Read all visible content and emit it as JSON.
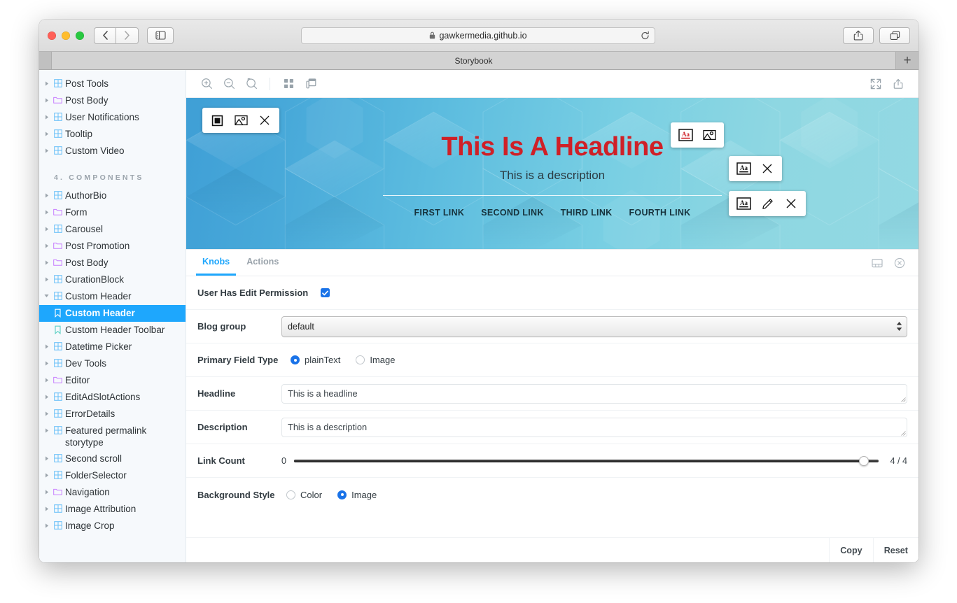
{
  "browser": {
    "url": "gawkermedia.github.io",
    "lock_icon": "lock-icon",
    "reload_icon": "reload-icon",
    "back_icon": "chevron-left-icon",
    "forward_icon": "chevron-right-icon",
    "sidebar_toggle_icon": "sidebar-toggle-icon",
    "share_icon": "share-icon",
    "tab_overview_icon": "tab-overview-icon",
    "tab_title": "Storybook",
    "new_tab_label": "+"
  },
  "sidebar": {
    "items": [
      {
        "label": "Post Tools",
        "type": "component",
        "caret": true,
        "selected": false
      },
      {
        "label": "Post Body",
        "type": "folder",
        "caret": true,
        "selected": false
      },
      {
        "label": "User Notifications",
        "type": "component",
        "caret": true,
        "selected": false
      },
      {
        "label": "Tooltip",
        "type": "component",
        "caret": true,
        "selected": false
      },
      {
        "label": "Custom Video",
        "type": "component",
        "caret": true,
        "selected": false
      }
    ],
    "group_title": "4. COMPONENTS",
    "components": [
      {
        "label": "AuthorBio",
        "type": "component",
        "caret": true,
        "selected": false
      },
      {
        "label": "Form",
        "type": "folder",
        "caret": true,
        "selected": false
      },
      {
        "label": "Carousel",
        "type": "component",
        "caret": true,
        "selected": false
      },
      {
        "label": "Post Promotion",
        "type": "folder",
        "caret": true,
        "selected": false
      },
      {
        "label": "Post Body",
        "type": "folder",
        "caret": true,
        "selected": false
      },
      {
        "label": "CurationBlock",
        "type": "component",
        "caret": true,
        "selected": false
      },
      {
        "label": "Custom Header",
        "type": "component",
        "caret": "open",
        "selected": false
      },
      {
        "label": "Custom Header",
        "type": "story",
        "caret": false,
        "selected": true
      },
      {
        "label": "Custom Header Toolbar",
        "type": "story",
        "caret": false,
        "selected": false
      },
      {
        "label": "Datetime Picker",
        "type": "component",
        "caret": true,
        "selected": false
      },
      {
        "label": "Dev Tools",
        "type": "component",
        "caret": true,
        "selected": false
      },
      {
        "label": "Editor",
        "type": "folder",
        "caret": true,
        "selected": false
      },
      {
        "label": "EditAdSlotActions",
        "type": "component",
        "caret": true,
        "selected": false
      },
      {
        "label": "ErrorDetails",
        "type": "component",
        "caret": true,
        "selected": false
      },
      {
        "label": "Featured permalink storytype",
        "type": "component",
        "caret": true,
        "selected": false
      },
      {
        "label": "Second scroll",
        "type": "component",
        "caret": true,
        "selected": false
      },
      {
        "label": "FolderSelector",
        "type": "component",
        "caret": true,
        "selected": false
      },
      {
        "label": "Navigation",
        "type": "folder",
        "caret": true,
        "selected": false
      },
      {
        "label": "Image Attribution",
        "type": "component",
        "caret": true,
        "selected": false
      },
      {
        "label": "Image Crop",
        "type": "component",
        "caret": true,
        "selected": false
      }
    ]
  },
  "preview_toolbar": {
    "zoom_in_icon": "zoom-in-icon",
    "zoom_out_icon": "zoom-out-icon",
    "zoom_reset_icon": "zoom-reset-icon",
    "grid_icon": "grid-icon",
    "background_icon": "layers-icon",
    "fullscreen_icon": "fullscreen-icon",
    "open_new_tab_icon": "share-icon"
  },
  "preview": {
    "headline": "This Is A Headline",
    "description": "This is a description",
    "links": [
      "FIRST LINK",
      "SECOND LINK",
      "THIRD LINK",
      "FOURTH LINK"
    ],
    "headline_color": "#cf2027",
    "description_color": "#2b3a41",
    "link_color": "#17333d",
    "bg_from": "#3f9fd6",
    "bg_to": "#93d9e3",
    "toolbars": {
      "background": {
        "icons": [
          "color-swatch-icon",
          "image-icon",
          "close-icon"
        ]
      },
      "headline": {
        "icons": [
          "text-format-red-icon",
          "image-icon"
        ]
      },
      "description": {
        "icons": [
          "text-format-icon",
          "close-icon"
        ]
      },
      "links": {
        "icons": [
          "text-format-icon",
          "pencil-icon",
          "close-icon"
        ]
      }
    }
  },
  "addon_panel": {
    "tabs": [
      {
        "label": "Knobs",
        "active": true
      },
      {
        "label": "Actions",
        "active": false
      }
    ],
    "position_icon": "panel-position-icon",
    "close_icon": "close-circle-icon",
    "knobs": {
      "user_has_edit_permission": {
        "label": "User Has Edit Permission",
        "checked": true
      },
      "blog_group": {
        "label": "Blog group",
        "value": "default",
        "options": [
          "default"
        ]
      },
      "primary_field_type": {
        "label": "Primary Field Type",
        "options": [
          {
            "label": "plainText",
            "selected": true
          },
          {
            "label": "Image",
            "selected": false
          }
        ]
      },
      "headline": {
        "label": "Headline",
        "value": "This is a headline"
      },
      "description": {
        "label": "Description",
        "value": "This is a description"
      },
      "link_count": {
        "label": "Link Count",
        "min": "0",
        "value": 4,
        "max": 4,
        "readout": "4 / 4"
      },
      "background_style": {
        "label": "Background Style",
        "options": [
          {
            "label": "Color",
            "selected": false
          },
          {
            "label": "Image",
            "selected": true
          }
        ]
      }
    },
    "footer": {
      "copy_label": "Copy",
      "reset_label": "Reset"
    }
  },
  "theme": {
    "accent": "#1EA7FD",
    "radio_blue": "#1a73e8",
    "sidebar_bg": "#f6f9fc"
  }
}
